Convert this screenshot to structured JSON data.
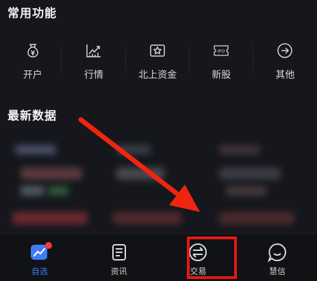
{
  "sections": {
    "common": "常用功能",
    "latest": "最新数据"
  },
  "functions": [
    {
      "label": "开户",
      "icon": "money-bag-icon"
    },
    {
      "label": "行情",
      "icon": "trend-chart-icon"
    },
    {
      "label": "北上资金",
      "icon": "bank-card-icon"
    },
    {
      "label": "新股",
      "icon": "ipo-ticket-icon"
    },
    {
      "label": "其他",
      "icon": "arrow-right-circle-icon"
    }
  ],
  "ipo_icon_text": "IPO",
  "tabs": [
    {
      "label": "自选",
      "icon": "chart-star-icon",
      "active": true
    },
    {
      "label": "资讯",
      "icon": "news-doc-icon",
      "active": false
    },
    {
      "label": "交易",
      "icon": "exchange-icon",
      "active": false
    },
    {
      "label": "慧信",
      "icon": "chat-bubble-icon",
      "active": false
    }
  ],
  "colors": {
    "accent": "#3f7cf5",
    "annotation": "#e8180f",
    "badge": "#f23a3a"
  }
}
